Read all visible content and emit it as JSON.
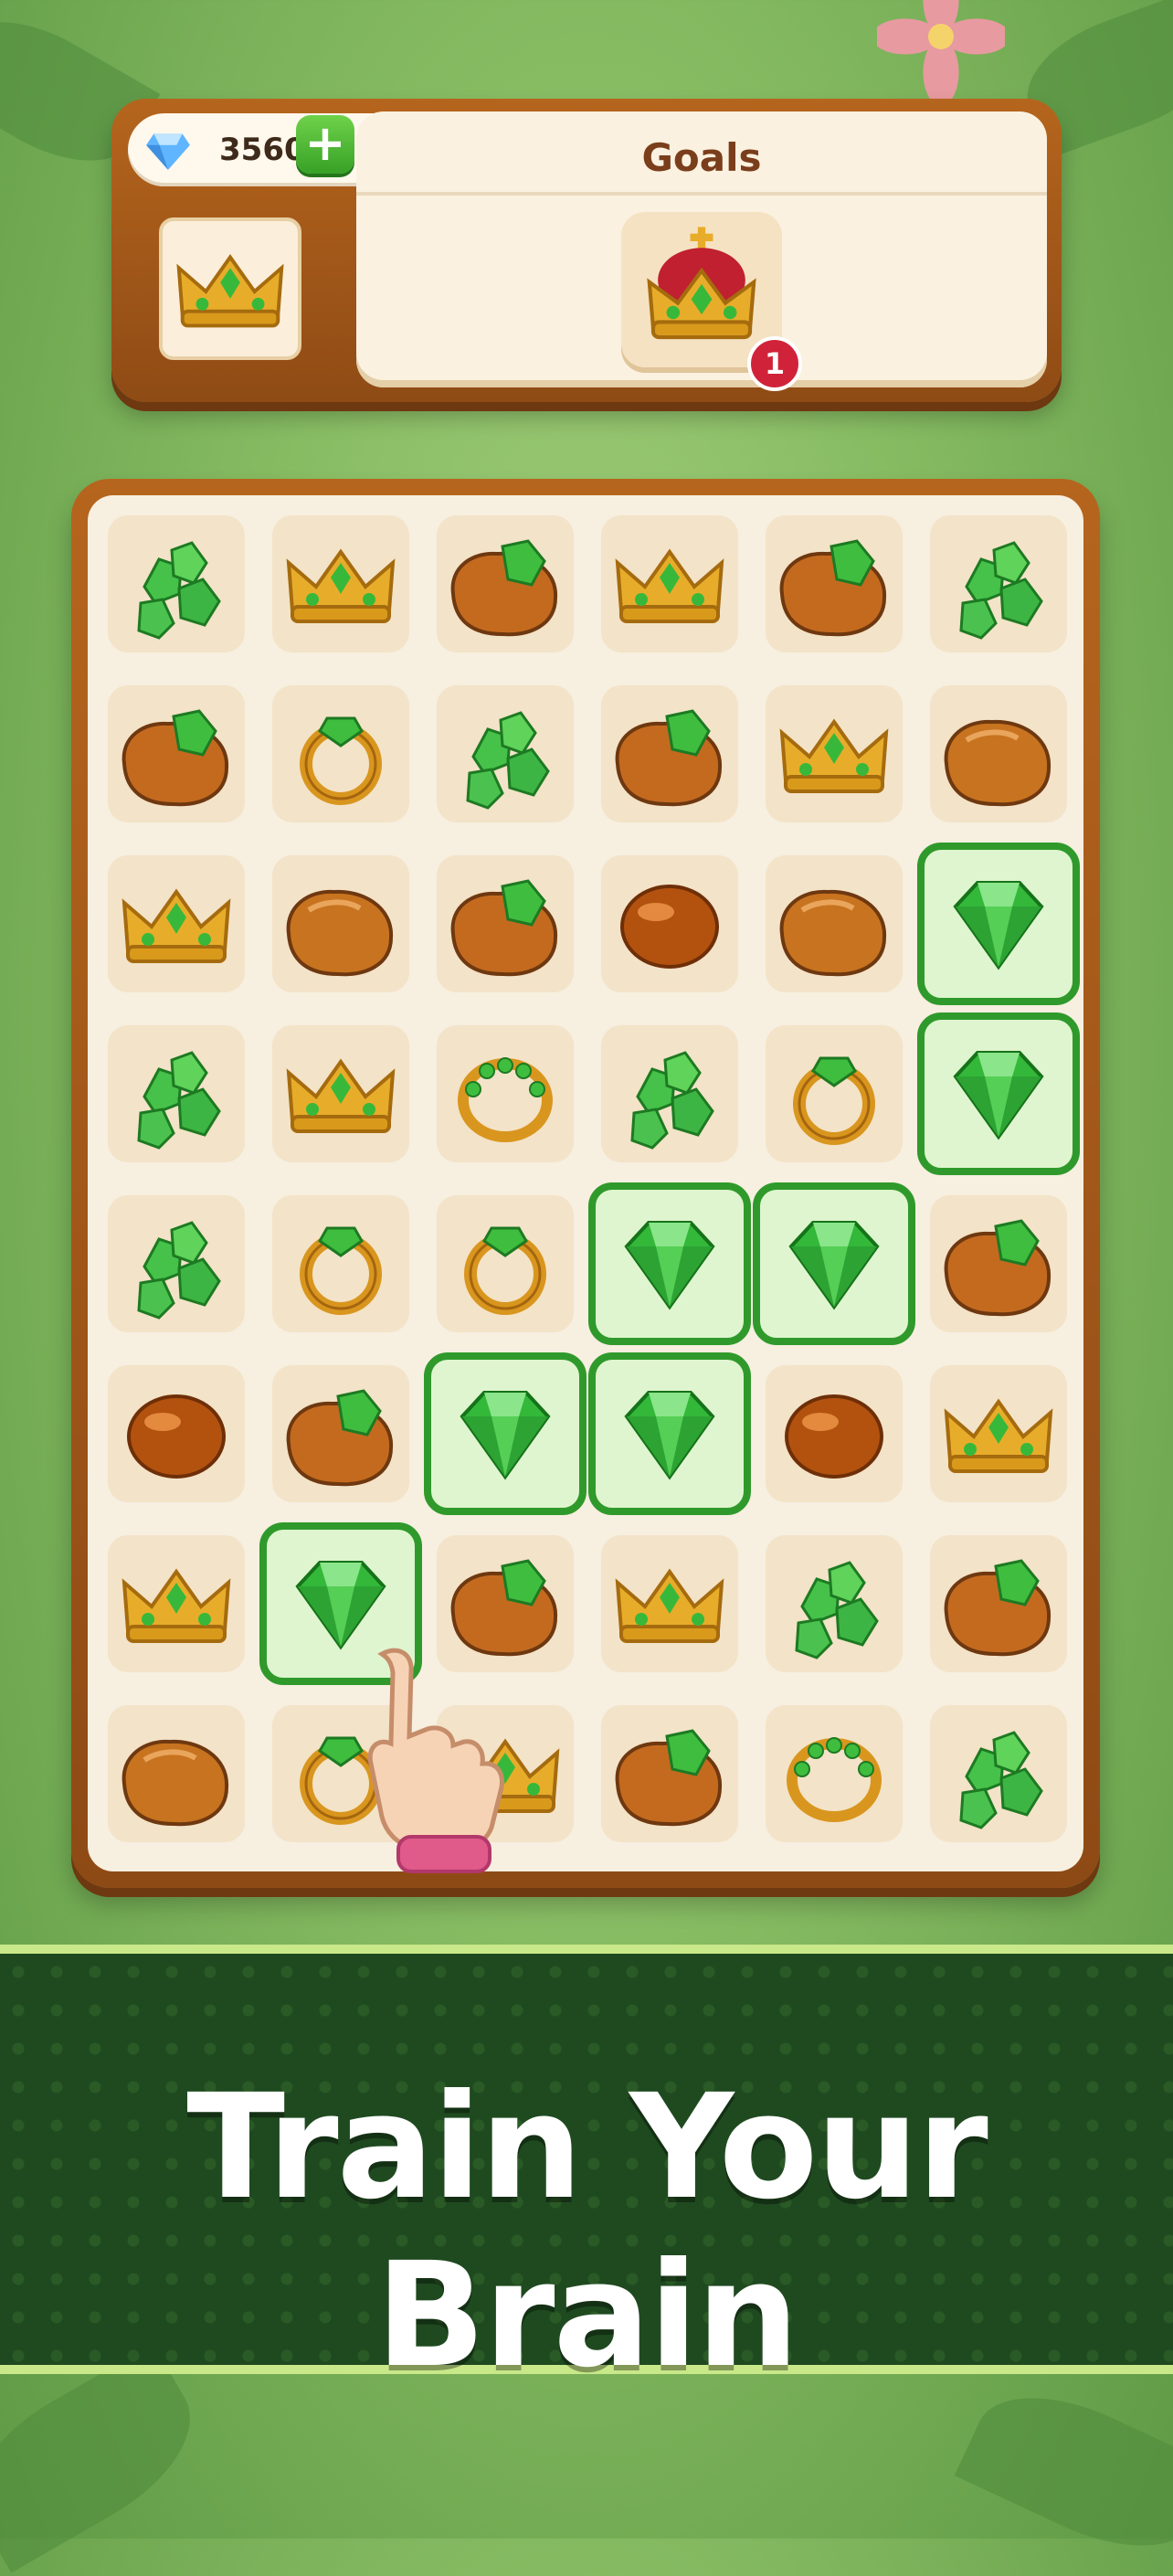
{
  "currency": {
    "value": "3560",
    "icon": "diamond-icon",
    "plus_label": "+"
  },
  "goals": {
    "title": "Goals",
    "target_icon": "royal-crown-icon",
    "count": "1"
  },
  "slot": {
    "icon": "crown-icon"
  },
  "board": {
    "rows": [
      [
        "clover",
        "crown",
        "orerock",
        "crown",
        "orerock",
        "clover"
      ],
      [
        "orerock",
        "ring",
        "clover",
        "orerock",
        "crown",
        "rock"
      ],
      [
        "crown",
        "rock",
        "orerock",
        "amber",
        "rock",
        "emerald"
      ],
      [
        "clover",
        "crown",
        "band",
        "clover",
        "ring",
        "emerald"
      ],
      [
        "clover",
        "ring",
        "ring",
        "emerald",
        "emerald",
        "orerock"
      ],
      [
        "amber",
        "orerock",
        "emerald",
        "emerald",
        "amber",
        "crown"
      ],
      [
        "crown",
        "emerald",
        "orerock",
        "crown",
        "clover",
        "orerock"
      ],
      [
        "rock",
        "ring",
        "crown",
        "orerock",
        "band",
        "clover"
      ]
    ],
    "selected_path": [
      [
        6,
        1
      ],
      [
        5,
        2
      ],
      [
        5,
        3
      ],
      [
        4,
        3
      ],
      [
        4,
        4
      ],
      [
        3,
        5
      ],
      [
        2,
        5
      ]
    ]
  },
  "banner": {
    "text": "Train Your Brain"
  },
  "colors": {
    "accent_green": "#2f9a2b",
    "wood": "#b5651d",
    "banner_bg": "#1f4a20"
  }
}
